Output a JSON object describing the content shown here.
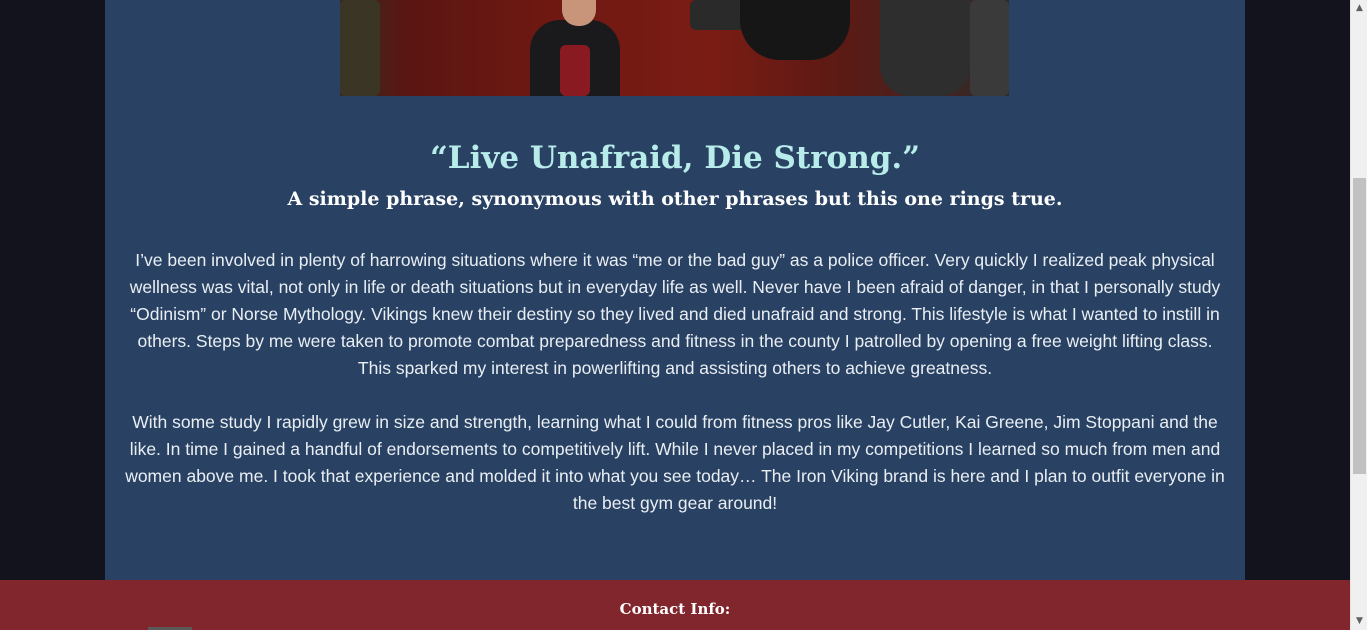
{
  "about": {
    "quote_title": "“Live Unafraid, Die Strong.”",
    "quote_subtitle": "A simple phrase, synonymous with other phrases but this one rings true.",
    "paragraph_1": "I’ve been involved in plenty of harrowing situations where it was “me or the bad guy” as a police officer. Very quickly I realized peak physical wellness was vital, not only in life or death situations but in everyday life as well. Never have I been afraid of danger, in that I personally study “Odinism” or Norse Mythology. Vikings knew their destiny so they lived and died unafraid and strong. This lifestyle is what I wanted to instill in others. Steps by me were taken to promote combat preparedness and fitness in the county I patrolled by opening a free weight lifting class. This sparked my interest in powerlifting and assisting others to achieve greatness.",
    "paragraph_2": "With some study I rapidly grew in size and strength, learning what I could from fitness pros like Jay Cutler, Kai Greene, Jim Stoppani and the like. In time I gained a handful of endorsements to competitively lift. While I never placed in my competitions I learned so much from men and women above me. I took that experience and molded it into what you see today… The Iron Viking brand is here and I plan to outfit everyone in the best gym gear around!"
  },
  "footer": {
    "contact_title": "Contact Info:"
  },
  "scrollbar": {
    "up_arrow": "▲",
    "down_arrow": "▼"
  },
  "colors": {
    "page_background": "#13131d",
    "content_panel": "#294263",
    "quote_title": "#b8ecea",
    "footer_band": "#82262d"
  }
}
